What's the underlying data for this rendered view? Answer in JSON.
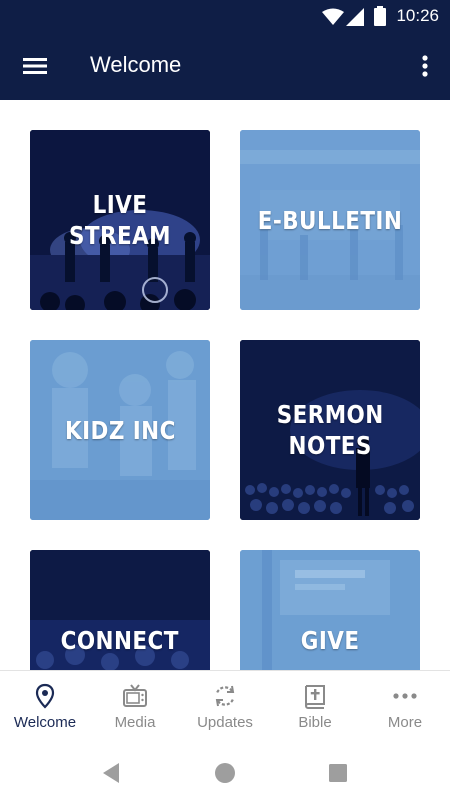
{
  "status_bar": {
    "time": "10:26"
  },
  "app_bar": {
    "title": "Welcome"
  },
  "tiles": [
    {
      "label": "LIVE STREAM",
      "style": "dark"
    },
    {
      "label": "E-BULLETIN",
      "style": "light"
    },
    {
      "label": "KIDZ INC",
      "style": "light"
    },
    {
      "label": "SERMON\nNOTES",
      "style": "dark"
    },
    {
      "label": "CONNECT",
      "style": "dark"
    },
    {
      "label": "GIVE",
      "style": "light"
    }
  ],
  "bottom_nav": [
    {
      "label": "Welcome",
      "icon": "location-pin-icon",
      "active": true
    },
    {
      "label": "Media",
      "icon": "tv-icon",
      "active": false
    },
    {
      "label": "Updates",
      "icon": "refresh-icon",
      "active": false
    },
    {
      "label": "Bible",
      "icon": "bible-icon",
      "active": false
    },
    {
      "label": "More",
      "icon": "more-horizontal-icon",
      "active": false
    }
  ],
  "colors": {
    "primary": "#0f1e46",
    "tile_dark": "#0d1a45",
    "tile_light": "#6d9fd2",
    "nav_active": "#1b2a55",
    "nav_inactive": "#8a8a8a"
  }
}
